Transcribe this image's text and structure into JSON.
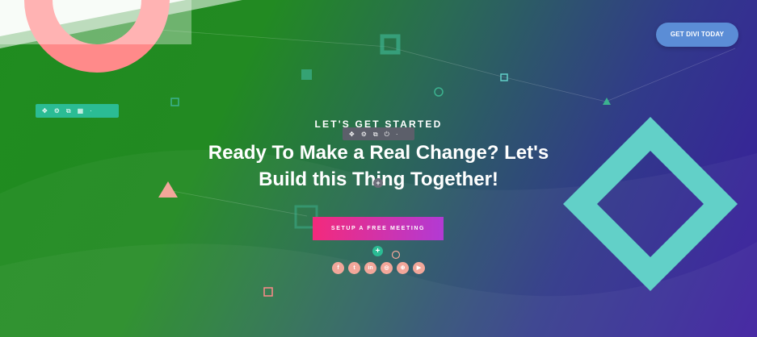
{
  "header": {
    "cta_label": "GET DIVI TODAY"
  },
  "hero": {
    "eyebrow": "LET'S GET STARTED",
    "headline_line1": "Ready To Make a Real Change? Let's",
    "headline_line2": "Build this Thing Together!",
    "cta_label": "SETUP A FREE MEETING"
  },
  "builder": {
    "row_toolbar_icons": [
      "move-icon",
      "gear-icon",
      "duplicate-icon",
      "columns-icon",
      "more-icon"
    ],
    "module_toolbar_icons": [
      "move-icon",
      "gear-icon",
      "duplicate-icon",
      "power-icon",
      "trash-icon"
    ],
    "add_symbol": "+"
  },
  "social": [
    {
      "name": "facebook-icon",
      "glyph": "f"
    },
    {
      "name": "twitter-icon",
      "glyph": "t"
    },
    {
      "name": "linkedin-icon",
      "glyph": "in"
    },
    {
      "name": "instagram-icon",
      "glyph": "◎"
    },
    {
      "name": "dribbble-icon",
      "glyph": "⊕"
    },
    {
      "name": "youtube-icon",
      "glyph": "▶"
    }
  ],
  "colors": {
    "green_bg": "#228a22",
    "purple_bg": "#3a1a9e",
    "accent_teal": "#2bbc94",
    "diamond": "#62d0c8",
    "arc": "#ff8a8a",
    "cta_start": "#f32a7c",
    "cta_end": "#b23ad4",
    "header_button": "#5b8dd6"
  }
}
